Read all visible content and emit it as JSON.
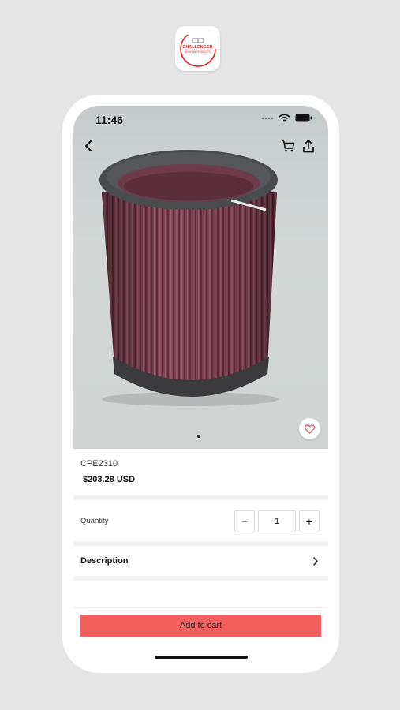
{
  "app_icon": {
    "brand_line1": "CHALLENGER",
    "brand_line2": "AVIATION PRODUCTS",
    "brand_color": "#d8232a"
  },
  "status_bar": {
    "time": "11:46",
    "icons": [
      "signal-icon",
      "wifi-icon",
      "battery-icon"
    ]
  },
  "nav": {
    "back_icon": "chevron-left-icon",
    "cart_icon": "cart-icon",
    "share_icon": "share-icon"
  },
  "product": {
    "sku": "CPE2310",
    "price": "$203.28 USD",
    "image_pager_total": 1,
    "image_pager_current": 1,
    "favorite_icon": "heart-icon"
  },
  "quantity": {
    "label": "Quantity",
    "decrement": "−",
    "value": "1",
    "increment": "+"
  },
  "description": {
    "label": "Description",
    "icon": "chevron-right-icon"
  },
  "cta": {
    "add_to_cart": "Add to cart",
    "color": "#f35e5e"
  }
}
